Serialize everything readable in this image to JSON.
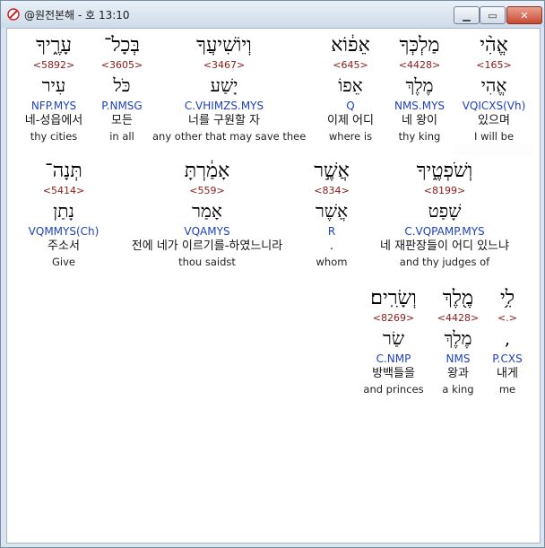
{
  "window": {
    "title": "@원전본해 - 호 13:10"
  },
  "rows": [
    {
      "words": [
        {
          "heb": "עָרֶ֑יךָ",
          "strong": "<5892>",
          "lemma": "עִיר",
          "morph": "NFP.MYS",
          "kor": "네-성읍에서",
          "eng": "thy cities"
        },
        {
          "heb": "בְּכָל־",
          "strong": "<3605>",
          "lemma": "כֹּל",
          "morph": "P.NMSG",
          "kor": "모든",
          "eng": "in all"
        },
        {
          "heb": "וְיוֹשִׁיעֲךָ",
          "strong": "<3467>",
          "lemma": "יָשַׁע",
          "morph": "C.VHIMZS.MYS",
          "kor": "너를 구원할 자",
          "eng": "any other that may save thee"
        },
        {
          "heb": "אֵפ֔וֹא",
          "strong": "<645>",
          "lemma": "אֵפוֹ",
          "morph": "Q",
          "kor": "이제 어디",
          "eng": "where is"
        },
        {
          "heb": "מַלְכְּךָ",
          "strong": "<4428>",
          "lemma": "מֶלֶךְ",
          "morph": "NMS.MYS",
          "kor": "네 왕이",
          "eng": "thy king"
        },
        {
          "heb": "אֱהִ֨י",
          "strong": "<165>",
          "lemma": "אֱהִי",
          "morph": "VQICXS(Vh)",
          "kor": "있으며",
          "eng": "I will be"
        }
      ]
    },
    {
      "words": [
        {
          "heb": "תְּנָה־",
          "strong": "<5414>",
          "lemma": "נָתַן",
          "morph": "VQMMYS(Ch)",
          "kor": "주소서",
          "eng": "Give"
        },
        {
          "heb": "אָמַ֔רְתָּ",
          "strong": "<559>",
          "lemma": "אָמַר",
          "morph": "VQAMYS",
          "kor": "전에 네가 이르기를-하였느니라",
          "eng": "thou saidst"
        },
        {
          "heb": "אֲשֶׁ֣ר",
          "strong": "<834>",
          "lemma": "אֲשֶׁר",
          "morph": "R",
          "kor": ".",
          "eng": "whom"
        },
        {
          "heb": "וְשֹׁפְטֶ֑יךָ",
          "strong": "<8199>",
          "lemma": "שָׁפַט",
          "morph": "C.VQPAMP.MYS",
          "kor": "네 재판장들이 어디 있느냐",
          "eng": "and thy judges of"
        }
      ]
    },
    {
      "words": [
        {
          "heb": "וְשָׂרִֽים׃",
          "strong": "<8269>",
          "lemma": "שַׂר",
          "morph": "C.NMP",
          "kor": "방백들을",
          "eng": "and princes"
        },
        {
          "heb": "מֶ֖לֶךְ",
          "strong": "<4428>",
          "lemma": "מֶלֶךְ",
          "morph": "NMS",
          "kor": "왕과",
          "eng": "a king"
        },
        {
          "heb": "לִ֥י",
          "strong": "<.>",
          "lemma": ",",
          "morph": "P.CXS",
          "kor": "내게",
          "eng": "me"
        }
      ]
    }
  ]
}
